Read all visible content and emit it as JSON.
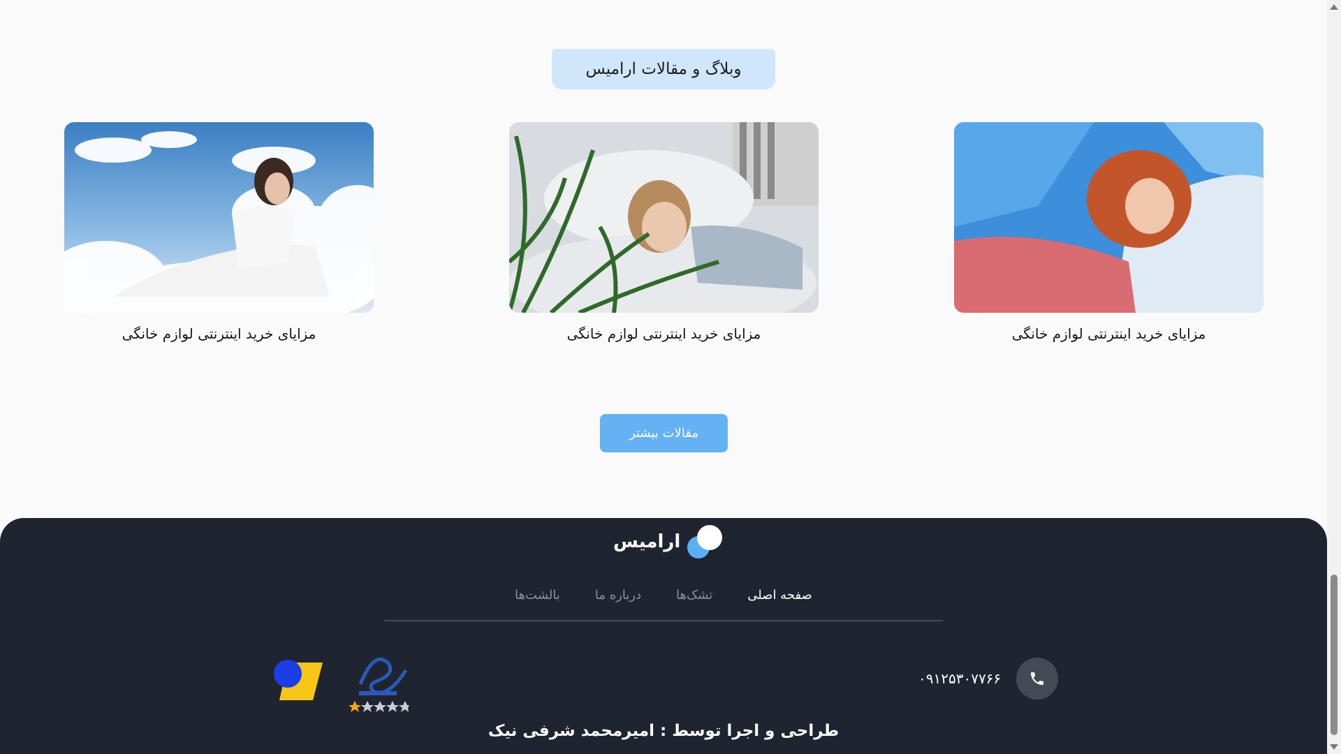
{
  "blog": {
    "title": "وبلاگ و مقالات ارامیس",
    "articles": [
      {
        "caption": "مزایای خرید اینترنتی لوازم خانگی",
        "image": "woman-sleeping-on-clouds"
      },
      {
        "caption": "مزایای خرید اینترنتی لوازم خانگی",
        "image": "child-resting-with-plant"
      },
      {
        "caption": "مزایای خرید اینترنتی لوازم خانگی",
        "image": "redhead-woman-sleeping"
      }
    ],
    "more_button": "مقالات بیشتر"
  },
  "footer": {
    "brand": "ارامیس",
    "nav": [
      "صفحه اصلی",
      "تشک‌ها",
      "درباره ما",
      "بالشت‌ها"
    ],
    "phone": "۰۹۱۲۵۳۰۷۷۶۶",
    "credit": "طراحی و اجرا توسط : امیرمحمد شرفی نیک"
  },
  "colors": {
    "accent": "#64b2f4",
    "pill": "#cfe6fb",
    "footer_bg": "#1f2530"
  }
}
